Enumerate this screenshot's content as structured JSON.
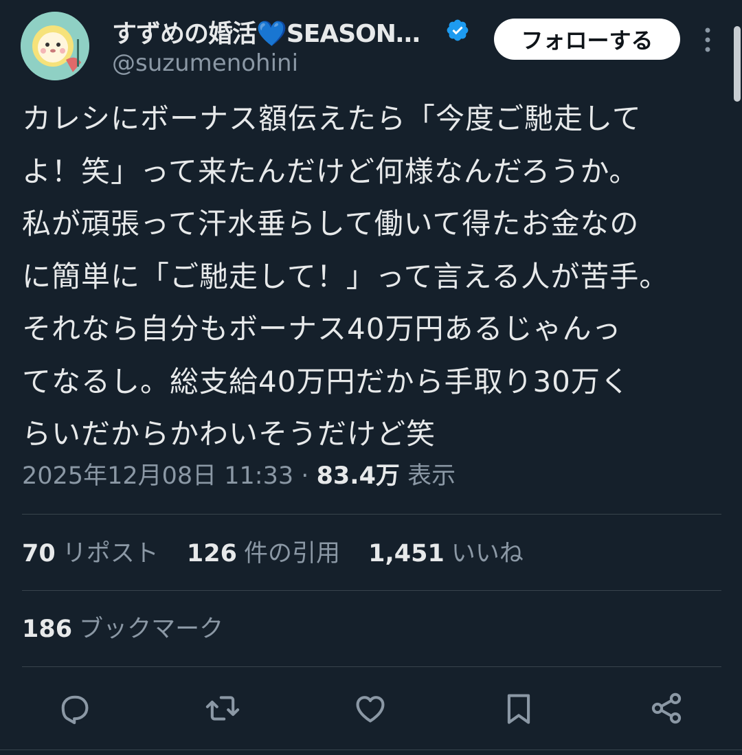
{
  "author": {
    "display_name": "すずめの婚活💙SEASON…",
    "handle": "@suzumenohini",
    "avatar_icon": "cartoon-lion-avatar",
    "verified_icon": "verified-badge-icon",
    "verified_color": "#1d9bf0"
  },
  "header": {
    "follow_label": "フォローする",
    "more_icon": "more-vertical-icon"
  },
  "tweet": {
    "lines": [
      "カレシにボーナス額伝えたら「今度ご馳走して",
      "よ！笑」って来たんだけど何様なんだろうか。",
      "私が頑張って汗水垂らして働いて得たお金なの",
      "に簡単に「ご馳走して！」って言える人が苦手。",
      "それなら自分もボーナス40万円あるじゃんっ",
      "てなるし。総支給40万円だから手取り30万く",
      "らいだからかわいそうだけど笑"
    ],
    "timestamp": "2025年12月08日 11:33",
    "separator": "·",
    "views_count": "83.4万",
    "views_label": "表示"
  },
  "stats": {
    "reposts_count": "70",
    "reposts_label": "リポスト",
    "quotes_count": "126",
    "quotes_label": "件の引用",
    "likes_count": "1,451",
    "likes_label": "いいね",
    "bookmarks_count": "186",
    "bookmarks_label": "ブックマーク"
  },
  "actions": [
    {
      "icon": "reply-icon"
    },
    {
      "icon": "retweet-icon"
    },
    {
      "icon": "like-heart-icon"
    },
    {
      "icon": "bookmark-icon"
    },
    {
      "icon": "share-icon"
    }
  ],
  "colors": {
    "background": "#15202b",
    "text_primary": "#e7e9ea",
    "text_secondary": "#8b98a5",
    "divider": "#38444d",
    "icon": "#8b98a5"
  }
}
